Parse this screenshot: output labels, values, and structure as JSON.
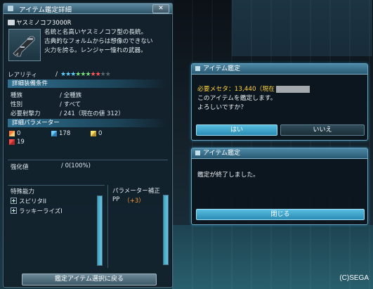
{
  "left_panel": {
    "title": "アイテム鑑定詳細",
    "close_label": "✕",
    "item_name": "ヤスミノコフ3000R",
    "description": [
      "名銃と名高いヤスミノコフ型の長銃。",
      "古典的なフォルムからは想像のできない",
      "火力を誇る。レンジャー憧れの武器。"
    ],
    "rarity_label": "レアリティ",
    "rarity_separator": "/",
    "rarity_stars": [
      "★",
      "★",
      "★",
      "★",
      "★",
      "★",
      "★",
      "★",
      "★",
      "★"
    ],
    "rarity_filled": 8,
    "section_requirements": "詳細装備条件",
    "requirements": [
      {
        "k": "種族",
        "v": "/ 全種族"
      },
      {
        "k": "性別",
        "v": "/ すべて"
      },
      {
        "k": "必要射撃力",
        "v": "/ 241（現在の値 312）"
      }
    ],
    "section_params": "詳細パラメーター",
    "params": [
      {
        "name": "attack",
        "value": "0"
      },
      {
        "name": "shoot",
        "value": "178"
      },
      {
        "name": "tech",
        "value": "0"
      },
      {
        "name": "def",
        "value": "19"
      }
    ],
    "grind_label": "強化値",
    "grind_value": "/ 0(100%)",
    "abilities_header": "特殊能力",
    "abilities": [
      "スピリタII",
      "ラッキーライズI"
    ],
    "param_mod_header": "パラメーター補正",
    "param_mod": {
      "name": "PP",
      "value": "（+3）"
    },
    "back_button": "鑑定アイテム選択に戻る"
  },
  "confirm_dialog": {
    "title": "アイテム鑑定",
    "cost_line": "必要メセタ：13,440（現在",
    "line2": "このアイテムを鑑定します。",
    "line3": "よろしいですか？",
    "yes": "はい",
    "no": "いいえ"
  },
  "done_dialog": {
    "title": "アイテム鑑定",
    "message": "鑑定が終了しました。",
    "close": "閉じる"
  },
  "copyright": "(C)SEGA",
  "colors": {
    "accent": "#58bde0",
    "mesta_yellow": "#ffd23a",
    "param_plus": "#ff9a3a"
  }
}
